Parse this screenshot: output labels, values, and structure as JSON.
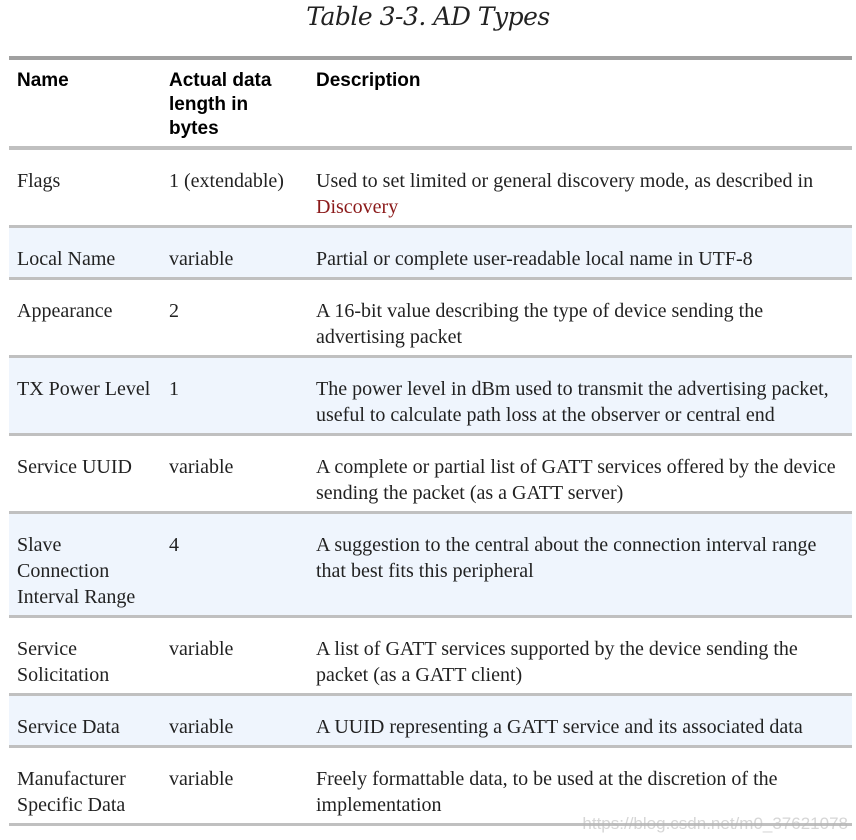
{
  "caption": "Table 3-3. AD Types",
  "table": {
    "headers": [
      "Name",
      "Actual data length in bytes",
      "Description"
    ],
    "rows": [
      {
        "name": "Flags",
        "length": "1 (extendable)",
        "description": "Used to set limited or general discovery mode, as described in ",
        "link": "Discovery"
      },
      {
        "name": "Local Name",
        "length": "variable",
        "description": "Partial or complete user-readable local name in UTF-8"
      },
      {
        "name": "Appearance",
        "length": "2",
        "description": "A 16-bit value describing the type of device sending the advertising packet"
      },
      {
        "name": "TX Power Level",
        "length": "1",
        "description": "The power level in dBm used to transmit the advertising packet, useful to calculate path loss at the observer or central end"
      },
      {
        "name": "Service UUID",
        "length": "variable",
        "description": "A complete or partial list of GATT services offered by the device sending the packet (as a GATT server)"
      },
      {
        "name": "Slave Connection Interval Range",
        "length": "4",
        "description": "A suggestion to the central about the connection interval range that best fits this peripheral"
      },
      {
        "name": "Service Solicitation",
        "length": "variable",
        "description": "A list of GATT services supported by the device sending the packet (as a GATT client)"
      },
      {
        "name": "Service Data",
        "length": "variable",
        "description": "A UUID representing a GATT service and its associated data"
      },
      {
        "name": "Manufacturer Specific Data",
        "length": "variable",
        "description": "Freely formattable data, to be used at the discretion of the implementation"
      }
    ]
  },
  "watermark": "https://blog.csdn.net/m0_37621078"
}
